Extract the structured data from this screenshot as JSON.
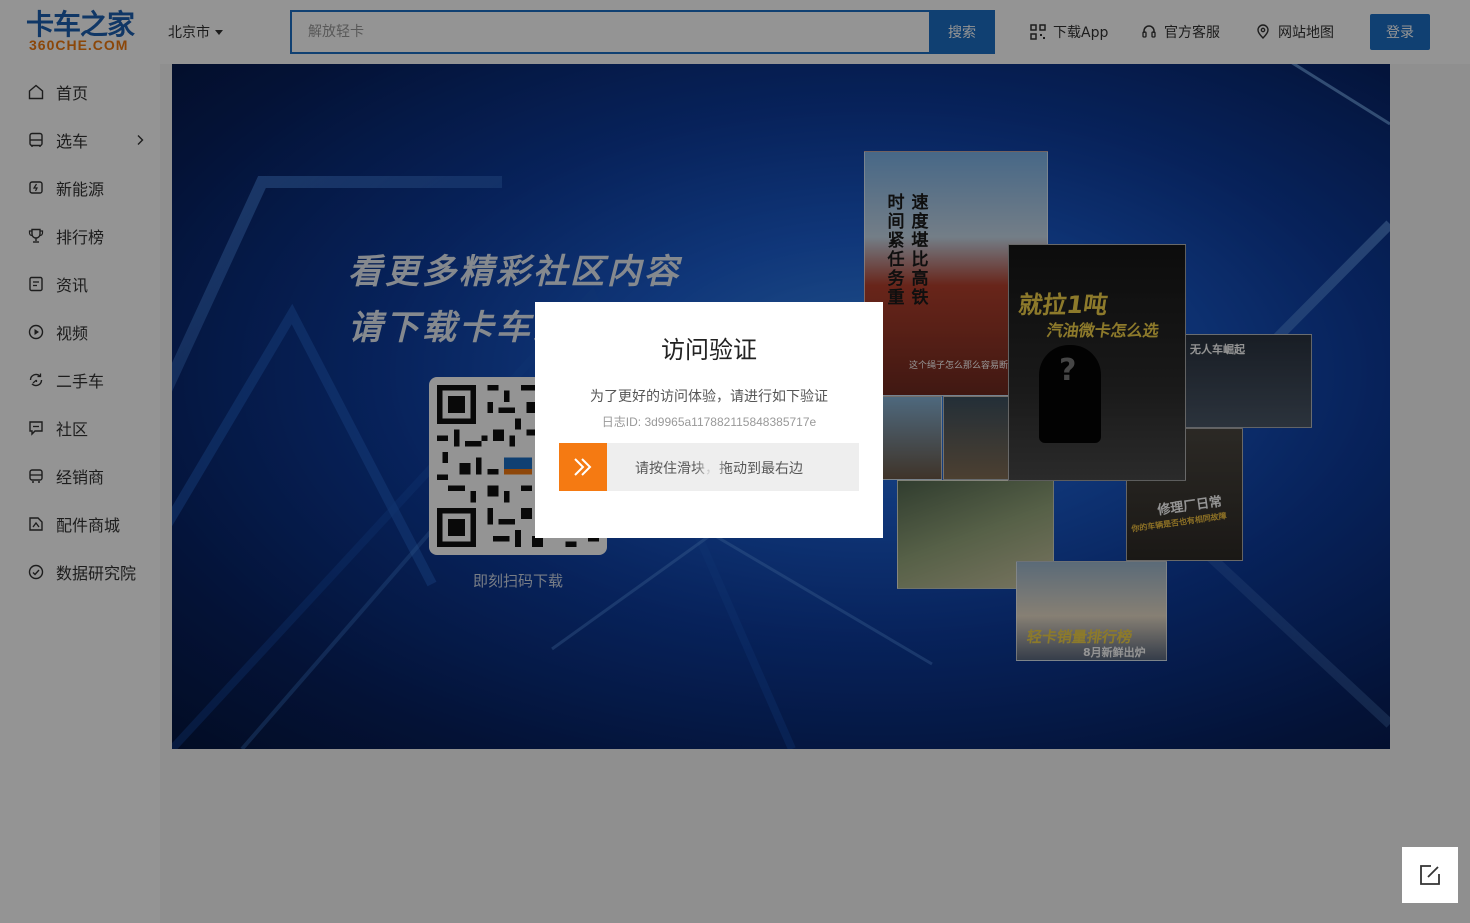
{
  "header": {
    "logo_text": "卡车之家",
    "logo_sub": "360CHE.COM",
    "city": "北京市",
    "search_placeholder": "解放轻卡",
    "search_button": "搜索",
    "links": [
      {
        "label": "下载App",
        "icon": "qr-grid-icon"
      },
      {
        "label": "官方客服",
        "icon": "headset-icon"
      },
      {
        "label": "网站地图",
        "icon": "map-pin-icon"
      }
    ],
    "login": "登录"
  },
  "sidebar": {
    "items": [
      {
        "label": "首页",
        "icon": "home-icon"
      },
      {
        "label": "选车",
        "icon": "truck-icon",
        "has_submenu": true
      },
      {
        "label": "新能源",
        "icon": "ev-truck-icon"
      },
      {
        "label": "排行榜",
        "icon": "trophy-icon"
      },
      {
        "label": "资讯",
        "icon": "news-icon"
      },
      {
        "label": "视频",
        "icon": "play-icon"
      },
      {
        "label": "二手车",
        "icon": "recycle-icon"
      },
      {
        "label": "社区",
        "icon": "chat-icon"
      },
      {
        "label": "经销商",
        "icon": "store-icon"
      },
      {
        "label": "配件商城",
        "icon": "parts-icon"
      },
      {
        "label": "数据研究院",
        "icon": "data-icon"
      }
    ]
  },
  "banner": {
    "headline_line1": "看更多精彩社区内容",
    "headline_line2": "请下载卡车之家APP",
    "qr_caption": "即刻扫码下载",
    "cards": [
      {
        "text_a": "时间紧任务重",
        "text_b": "速度堪比高铁",
        "caption": "这个绳子怎么那么容易断"
      },
      {
        "title": "就拉1吨",
        "subtitle": "汽油微卡怎么选"
      },
      {
        "title": "无人车崛起"
      },
      {
        "title": "修理厂日常",
        "subtitle": "你的车辆是否也有相同故障"
      },
      {
        "title": "轻卡销量排行榜",
        "subtitle": "8月新鲜出炉"
      }
    ]
  },
  "modal": {
    "title": "访问验证",
    "description": "为了更好的访问体验，请进行如下验证",
    "log_id": "日志ID: 3d9965a117882115848385717e",
    "slider_hint": "请按住滑块，拖动到最右边"
  },
  "colors": {
    "brand_blue": "#1d6fc4",
    "accent_orange": "#f57a12"
  },
  "floating": {
    "feedback_icon": "edit-icon"
  }
}
